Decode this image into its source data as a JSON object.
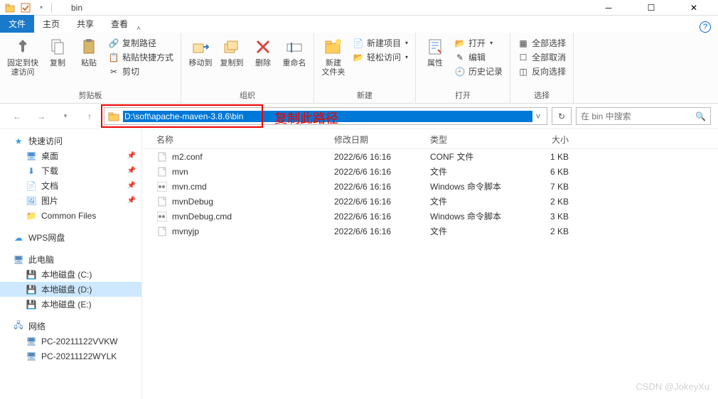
{
  "title": "bin",
  "tabs": {
    "file": "文件",
    "home": "主页",
    "share": "共享",
    "view": "查看"
  },
  "ribbon": {
    "clipboard": {
      "pin": "固定到快\n速访问",
      "copy": "复制",
      "paste": "粘贴",
      "copy_path": "复制路径",
      "paste_shortcut": "粘贴快捷方式",
      "cut": "剪切",
      "label": "剪贴板"
    },
    "organize": {
      "move": "移动到",
      "copy": "复制到",
      "delete": "删除",
      "rename": "重命名",
      "label": "组织"
    },
    "new": {
      "folder": "新建\n文件夹",
      "item": "新建项目",
      "easy": "轻松访问",
      "label": "新建"
    },
    "open": {
      "props": "属性",
      "open": "打开",
      "edit": "编辑",
      "history": "历史记录",
      "label": "打开"
    },
    "select": {
      "all": "全部选择",
      "none": "全部取消",
      "invert": "反向选择",
      "label": "选择"
    }
  },
  "address": "D:\\soft\\apache-maven-3.8.6\\bin",
  "annotation": "复制此路径",
  "search": {
    "placeholder": "在 bin 中搜索"
  },
  "cols": {
    "name": "名称",
    "date": "修改日期",
    "type": "类型",
    "size": "大小"
  },
  "sidebar": {
    "quick": {
      "label": "快速访问",
      "items": [
        "桌面",
        "下载",
        "文档",
        "图片",
        "Common Files"
      ]
    },
    "wps": "WPS网盘",
    "pc": {
      "label": "此电脑",
      "drives": [
        "本地磁盘 (C:)",
        "本地磁盘 (D:)",
        "本地磁盘 (E:)"
      ]
    },
    "net": {
      "label": "网络",
      "items": [
        "PC-20211122VVKW",
        "PC-20211122WYLK"
      ]
    }
  },
  "files": [
    {
      "name": "m2.conf",
      "date": "2022/6/6 16:16",
      "type": "CONF 文件",
      "size": "1 KB",
      "icon": "file"
    },
    {
      "name": "mvn",
      "date": "2022/6/6 16:16",
      "type": "文件",
      "size": "6 KB",
      "icon": "file"
    },
    {
      "name": "mvn.cmd",
      "date": "2022/6/6 16:16",
      "type": "Windows 命令脚本",
      "size": "7 KB",
      "icon": "cmd"
    },
    {
      "name": "mvnDebug",
      "date": "2022/6/6 16:16",
      "type": "文件",
      "size": "2 KB",
      "icon": "file"
    },
    {
      "name": "mvnDebug.cmd",
      "date": "2022/6/6 16:16",
      "type": "Windows 命令脚本",
      "size": "3 KB",
      "icon": "cmd"
    },
    {
      "name": "mvnyjp",
      "date": "2022/6/6 16:16",
      "type": "文件",
      "size": "2 KB",
      "icon": "file"
    }
  ],
  "watermark": "CSDN @JokeyXu"
}
